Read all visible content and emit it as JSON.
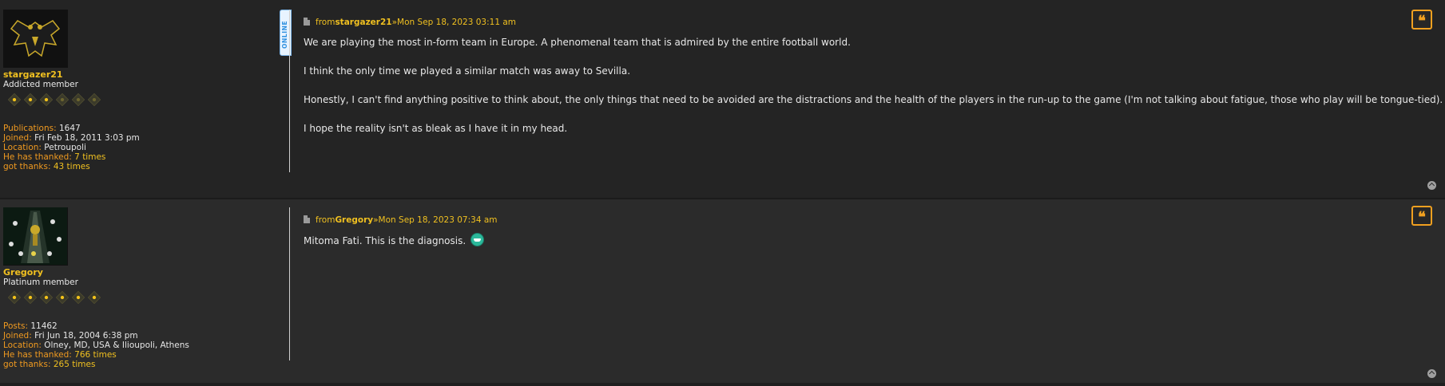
{
  "posts": [
    {
      "user": {
        "name": "stargazer21",
        "rank": "Addicted member",
        "stats": [
          {
            "label": "Publications:",
            "value": "1647"
          },
          {
            "label": "Joined:",
            "value": "Fri Feb 18, 2011 3:03 pm"
          },
          {
            "label": "Location:",
            "value": "Petroupoli"
          },
          {
            "label": "He has thanked:",
            "value": "7 times"
          },
          {
            "label": "got thanks:",
            "value": "43 times"
          }
        ],
        "stars_filled": 3,
        "stars_total": 6,
        "online_label": "ONLINE"
      },
      "meta": {
        "prefix": "from",
        "author": "stargazer21",
        "separator": "»",
        "date": "Mon Sep 18, 2023 03:11 am"
      },
      "paragraphs": [
        "We are playing the most in-form team in Europe. A phenomenal team that is admired by the entire football world.",
        "I think the only time we played a similar match was away to Sevilla.",
        "Honestly, I can't find anything positive to think about, the only things that need to be avoided are the distractions and the health of the players in the run-up to the game (I'm not talking about fatigue, those who play will be tongue-tied).",
        "I hope the reality isn't as bleak as I have it in my head."
      ]
    },
    {
      "user": {
        "name": "Gregory",
        "rank": "Platinum member",
        "stats": [
          {
            "label": "Posts:",
            "value": "11462"
          },
          {
            "label": "Joined:",
            "value": "Fri Jun 18, 2004 6:38 pm"
          },
          {
            "label": "Location:",
            "value": "Olney, MD, USA & Ilioupoli, Athens"
          },
          {
            "label": "He has thanked:",
            "value": "766 times"
          },
          {
            "label": "got thanks:",
            "value": "265 times"
          }
        ],
        "stars_filled": 6,
        "stars_total": 6
      },
      "meta": {
        "prefix": "from",
        "author": "Gregory",
        "separator": "»",
        "date": "Mon Sep 18, 2023 07:34 am"
      },
      "paragraphs": [
        "Mitoma Fati. This is the diagnosis."
      ],
      "smiley": "grin-smiley-icon"
    }
  ],
  "colors": {
    "accent": "#f0c020",
    "label": "#f09a20",
    "quote": "#f0a020"
  }
}
